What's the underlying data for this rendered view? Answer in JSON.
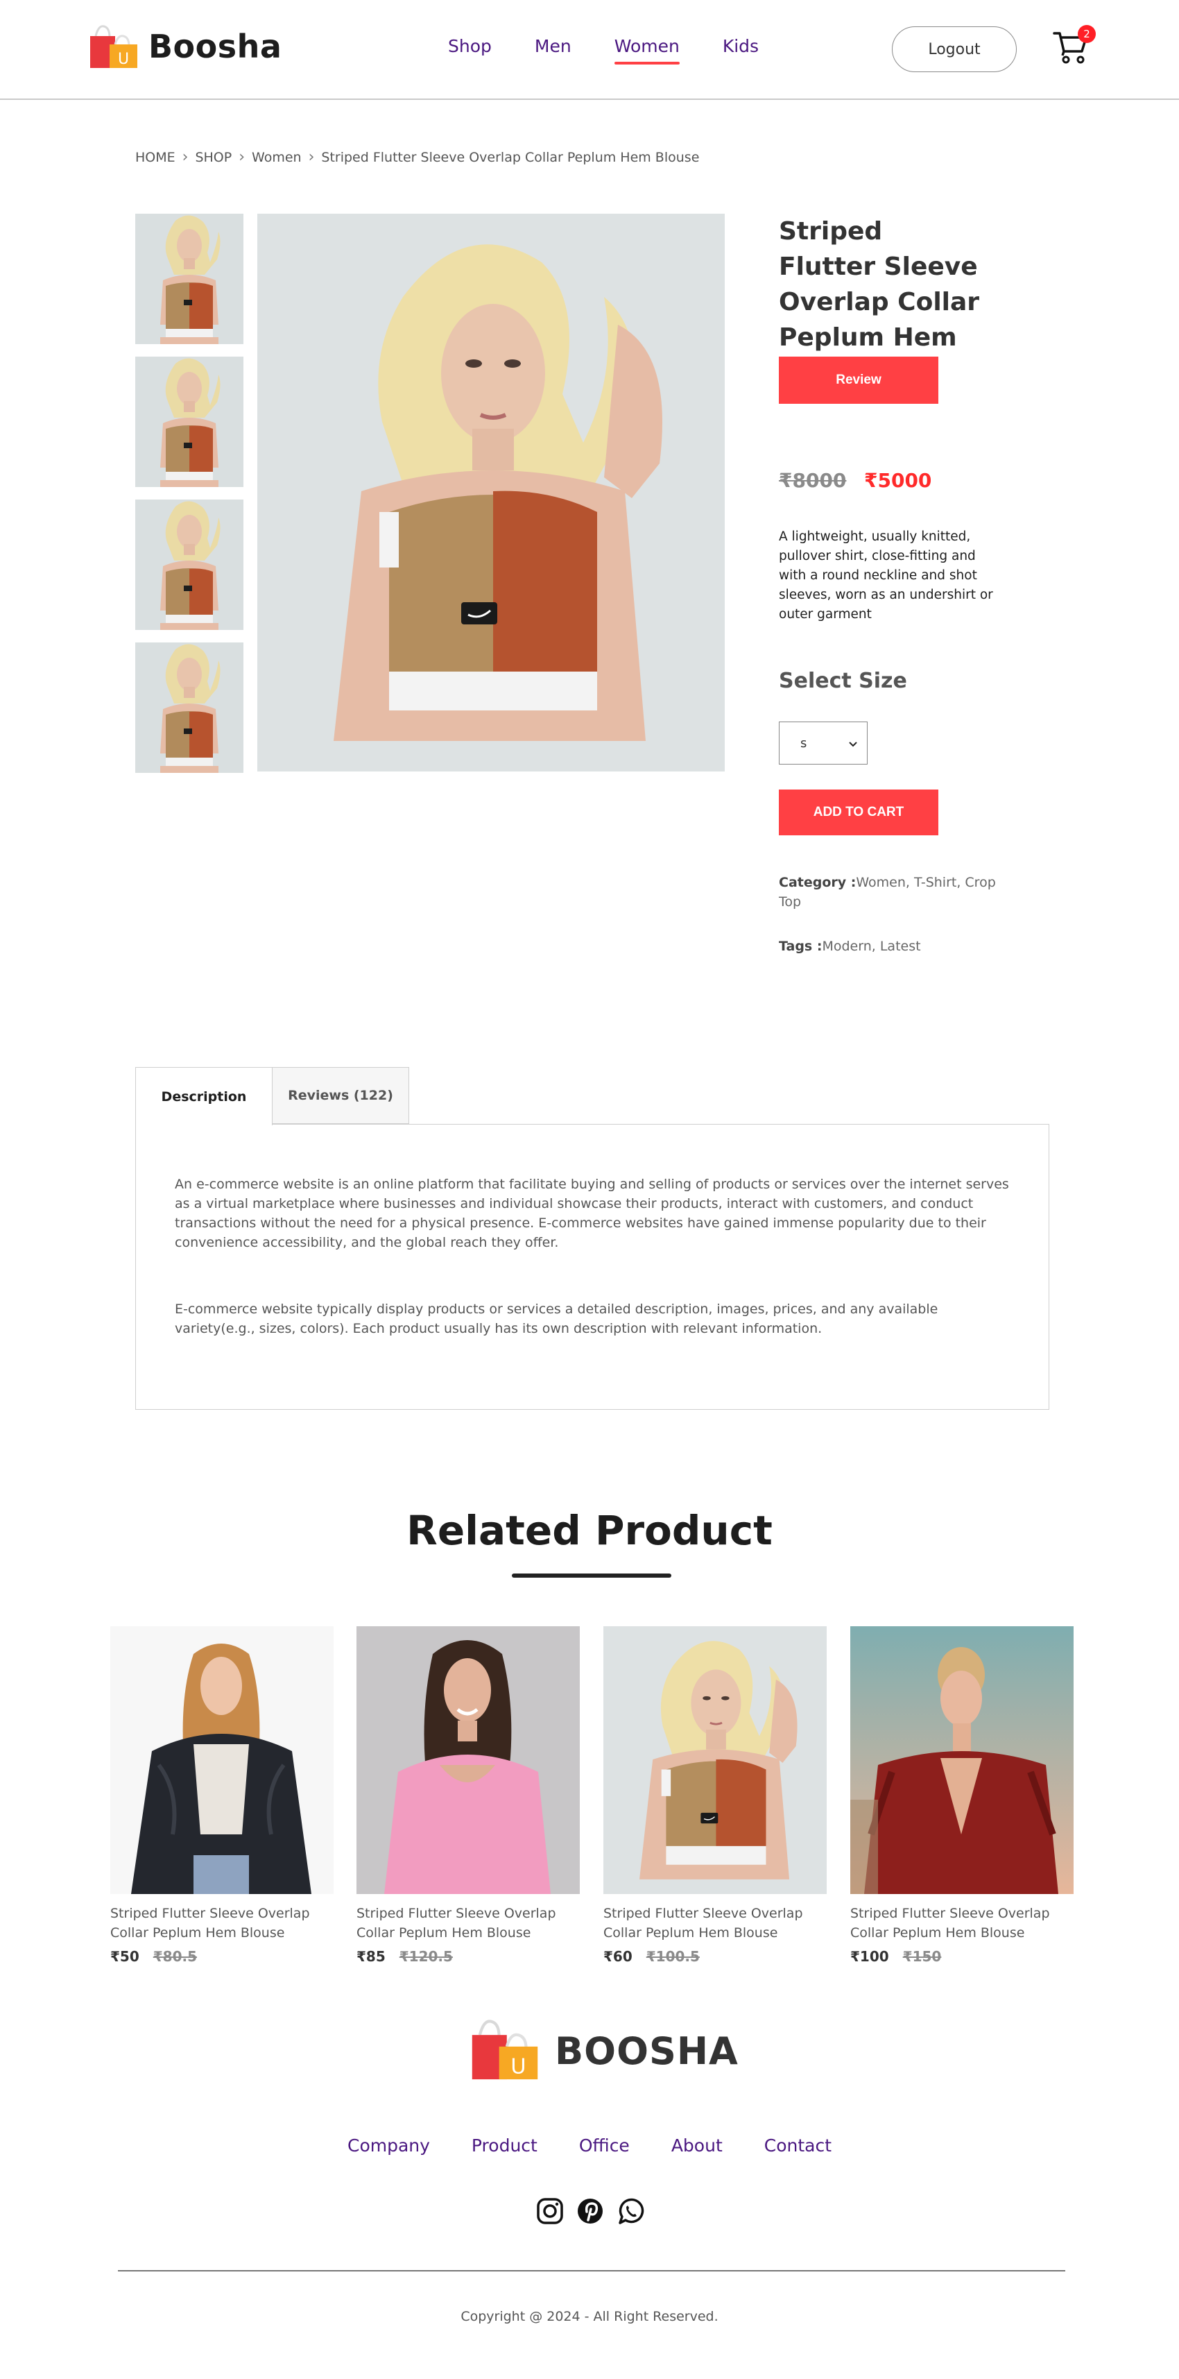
{
  "header": {
    "brand": "Boosha",
    "nav": [
      "Shop",
      "Men",
      "Women",
      "Kids"
    ],
    "active_nav": "Women",
    "logout_label": "Logout",
    "cart_count": "2"
  },
  "breadcrumb": [
    "HOME",
    "SHOP",
    "Women",
    "Striped Flutter Sleeve Overlap Collar Peplum Hem Blouse"
  ],
  "product": {
    "title": "Striped Flutter Sleeve Overlap Collar Peplum Hem Blouse",
    "review_label": "Review",
    "price_old": "₹8000",
    "price_new": "₹5000",
    "description": "A lightweight, usually knitted, pullover shirt, close-fitting and with a round neckline and shot sleeves, worn as an undershirt or outer garment",
    "size_label": "Select Size",
    "size_selected": "S",
    "add_to_cart_label": "ADD TO CART",
    "category_label": "Category :",
    "category_value": "Women, T-Shirt, Crop Top",
    "tags_label": "Tags :",
    "tags_value": "Modern, Latest"
  },
  "tabs": {
    "description_label": "Description",
    "reviews_label": "Reviews (122)",
    "paragraph_1": "An e-commerce website is an online platform that facilitate buying and selling of products or services over the internet serves as a virtual marketplace where businesses and individual showcase their products, interact with customers, and conduct transactions without the need for a physical presence. E-commerce websites have gained immense popularity due to their convenience accessibility, and the global reach they offer.",
    "paragraph_2": "E-commerce website typically display products or services a detailed description, images, prices, and any available variety(e.g., sizes, colors). Each product usually has its own description with relevant information."
  },
  "related": {
    "title": "Related Product",
    "items": [
      {
        "name": "Striped Flutter Sleeve Overlap Collar Peplum Hem Blouse",
        "price": "₹50",
        "old_price": "₹80.5"
      },
      {
        "name": "Striped Flutter Sleeve Overlap Collar Peplum Hem Blouse",
        "price": "₹85",
        "old_price": "₹120.5"
      },
      {
        "name": "Striped Flutter Sleeve Overlap Collar Peplum Hem Blouse",
        "price": "₹60",
        "old_price": "₹100.5"
      },
      {
        "name": "Striped Flutter Sleeve Overlap Collar Peplum Hem Blouse",
        "price": "₹100",
        "old_price": "₹150"
      }
    ]
  },
  "footer": {
    "brand": "BOOSHA",
    "nav": [
      "Company",
      "Product",
      "Office",
      "About",
      "Contact"
    ],
    "socials": [
      "instagram-icon",
      "pinterest-icon",
      "whatsapp-icon"
    ],
    "copyright": "Copyright @ 2024 - All Right Reserved."
  },
  "colors": {
    "accent": "#ff4044",
    "nav_text": "#4a1780",
    "price_red": "#ff2a2a"
  }
}
